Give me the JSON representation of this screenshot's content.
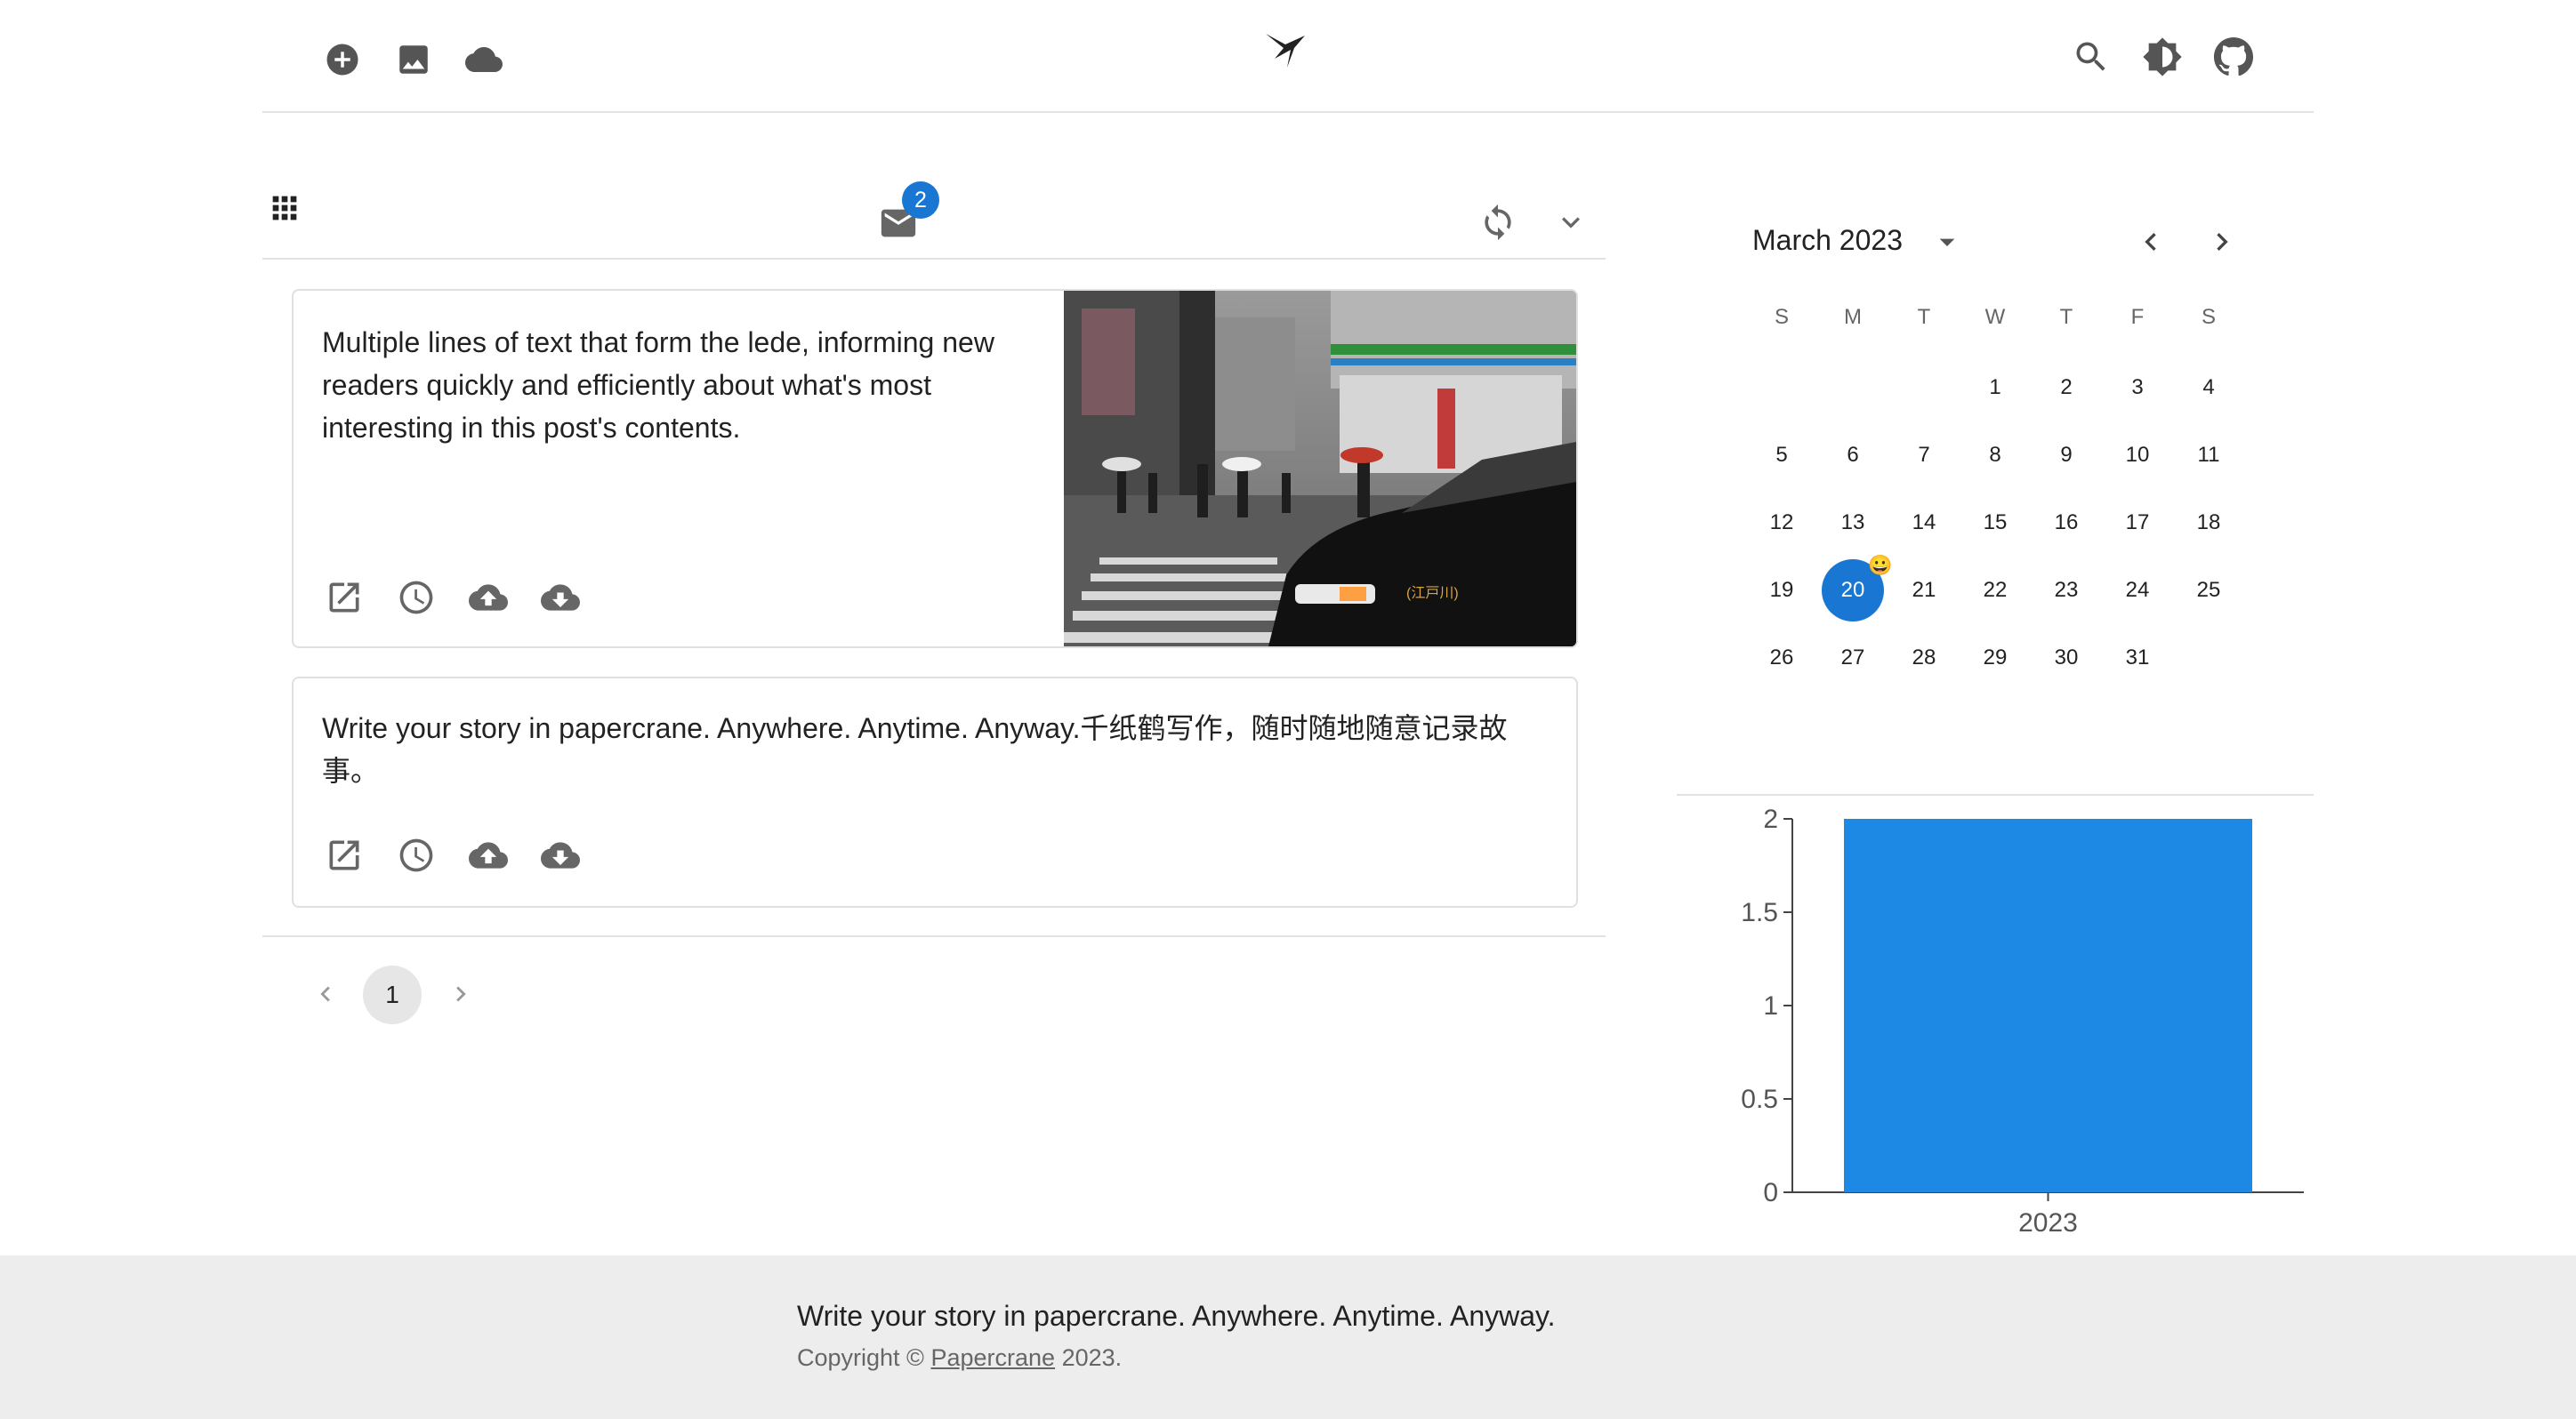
{
  "header": {
    "left_icons": [
      "add-circle-icon",
      "image-icon",
      "cloud-icon"
    ],
    "logo": "paper-crane-logo",
    "right_icons": [
      "search-icon",
      "brightness-icon",
      "github-icon"
    ]
  },
  "toolbar": {
    "grid_icon": "apps-icon",
    "mail_icon": "mail-icon",
    "mail_badge": "2",
    "refresh_icon": "sync-icon",
    "expand_icon": "chevron-down-icon"
  },
  "posts": [
    {
      "text": "Multiple lines of text that form the lede, informing new readers quickly and efficiently about what's most interesting in this post's contents.",
      "has_image": true,
      "image_sign": "(江戸川)",
      "actions": [
        "open-in-new-icon",
        "clock-icon",
        "cloud-upload-icon",
        "cloud-download-icon"
      ]
    },
    {
      "text": "Write your story in papercrane. Anywhere. Anytime. Anyway.千纸鹤写作，随时随地随意记录故事。",
      "has_image": false,
      "actions": [
        "open-in-new-icon",
        "clock-icon",
        "cloud-upload-icon",
        "cloud-download-icon"
      ]
    }
  ],
  "pagination": {
    "current": "1",
    "prev_icon": "chevron-left-icon",
    "next_icon": "chevron-right-icon"
  },
  "calendar": {
    "month_label": "March 2023",
    "weekdays": [
      "S",
      "M",
      "T",
      "W",
      "T",
      "F",
      "S"
    ],
    "first_weekday_index": 3,
    "days_in_month": 31,
    "selected_day": 20,
    "selected_day_marker": "😀",
    "accent": "#1976d2"
  },
  "chart_data": {
    "type": "bar",
    "categories": [
      "2023"
    ],
    "values": [
      2
    ],
    "ylim": [
      0,
      2
    ],
    "yticks": [
      "0",
      "0.5",
      "1",
      "1.5",
      "2"
    ],
    "title": "",
    "xlabel": "",
    "ylabel": "",
    "color": "#1e88e5"
  },
  "footer": {
    "tagline": "Write your story in papercrane. Anywhere. Anytime. Anyway.",
    "copyright_prefix": "Copyright ©",
    "copyright_link": "Papercrane",
    "copyright_suffix": "2023."
  }
}
